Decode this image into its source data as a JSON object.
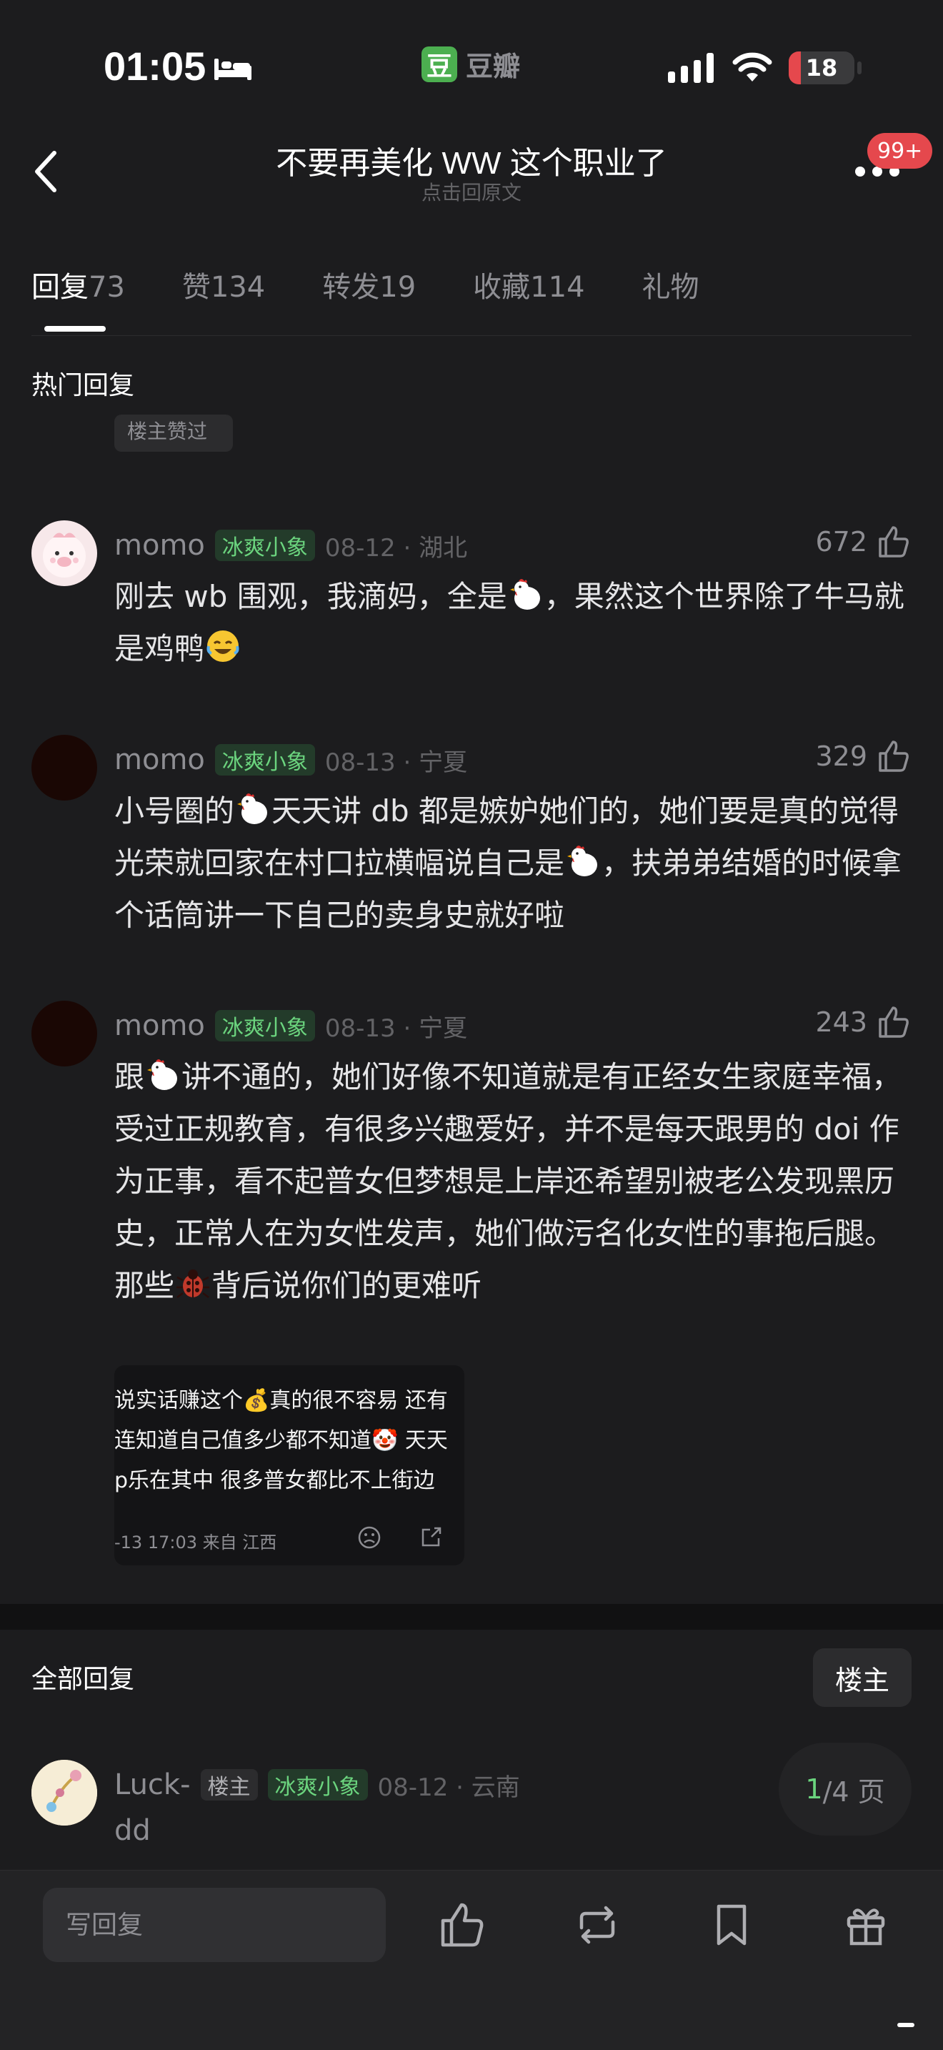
{
  "status_bar": {
    "time": "01:05",
    "app_logo": "豆",
    "app_name": "豆瓣",
    "battery": "18",
    "battery_level": 0.18
  },
  "nav": {
    "title": "不要再美化 WW 这个职业了",
    "subtitle": "点击回原文",
    "badge": "99+"
  },
  "tabs": [
    {
      "label": "回复",
      "count": "73"
    },
    {
      "label": "赞",
      "count": "134"
    },
    {
      "label": "转发",
      "count": "19"
    },
    {
      "label": "收藏",
      "count": "114"
    },
    {
      "label": "礼物",
      "count": ""
    }
  ],
  "hot_section": {
    "title": "热门回复",
    "clipped_chip": "楼主赞过"
  },
  "comments": [
    {
      "name": "momo",
      "badge": "冰爽小象",
      "date": "08-12 · 湖北",
      "likes": "672",
      "body_parts": [
        "刚去 wb 围观，我滴妈，全是",
        "，果然这个世界除了牛马就是鸡鸭"
      ]
    },
    {
      "name": "momo",
      "badge": "冰爽小象",
      "date": "08-13 · 宁夏",
      "likes": "329",
      "body_parts": [
        "小号圈的",
        "天天讲 db 都是嫉妒她们的，她们要是真的觉得光荣就回家在村口拉横幅说自己是",
        "，扶弟弟结婚的时候拿个话筒讲一下自己的卖身史就好啦"
      ]
    },
    {
      "name": "momo",
      "badge": "冰爽小象",
      "date": "08-13 · 宁夏",
      "likes": "243",
      "body_parts": [
        "跟",
        "讲不通的，她们好像不知道就是有正经女生家庭幸福，受过正规教育，有很多兴趣爱好，并不是每天跟男的 doi 作为正事，看不起普女但梦想是上岸还希望别被老公发现黑历史，正常人在为女性发声，她们做污名化女性的事拖后腿。那些",
        "背后说你们的更难听"
      ],
      "image": {
        "line1": "说实话赚这个💰真的很不容易 还有",
        "line2": "连知道自己值多少都不知道🤡 天天",
        "line3": "p乐在其中 很多普女都比不上街边",
        "meta": "-13 17:03 来自 江西"
      }
    }
  ],
  "all_section": {
    "title": "全部回复",
    "op_filter": "楼主"
  },
  "last_comment": {
    "name_line1": "Luck-",
    "name_line2": "dd",
    "host": "楼主",
    "badge": "冰爽小象",
    "date": "08-12 · 云南"
  },
  "pagination": {
    "current": "1",
    "total": "/4 页"
  },
  "bottom_bar": {
    "reply_placeholder": "写回复"
  },
  "icons": [
    "bed-icon",
    "wifi-icon",
    "signal-icon",
    "back-icon",
    "more-icon",
    "thumb-up-icon",
    "repost-icon",
    "bookmark-icon",
    "gift-icon",
    "chicken-emoji-icon",
    "bug-emoji-icon",
    "laugh-emoji-icon"
  ],
  "colors": {
    "background": "#1c1c1e",
    "accent_green": "#6bd47e",
    "badge_red": "#e5484d"
  }
}
